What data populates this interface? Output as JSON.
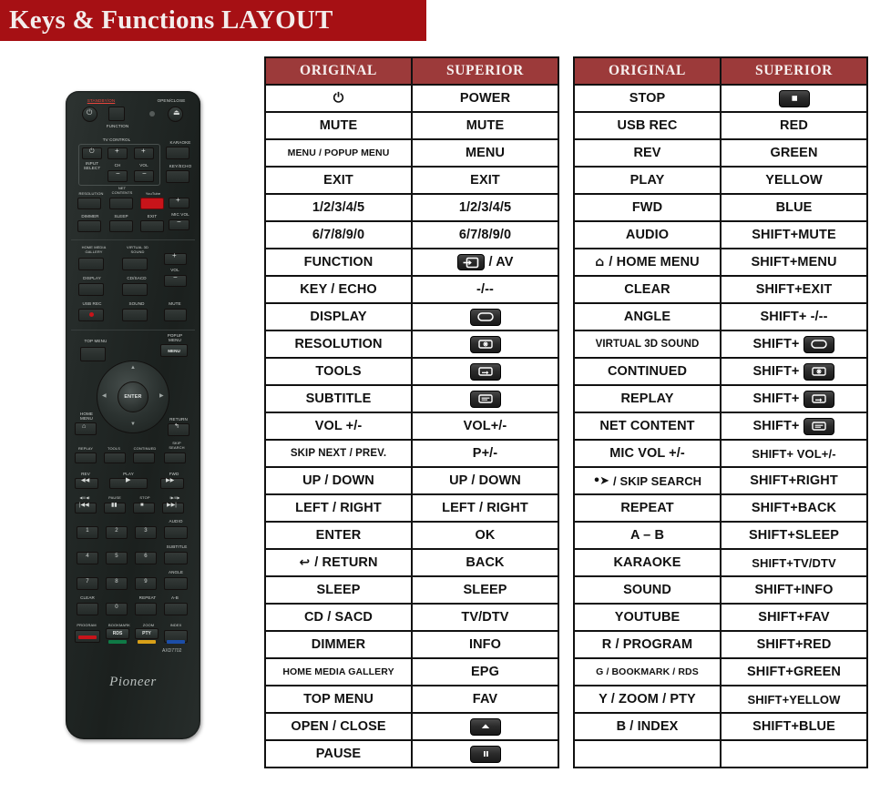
{
  "banner": {
    "title": "Keys & Functions LAYOUT"
  },
  "remote": {
    "brand": "Pioneer",
    "model": "AXD7702",
    "labels": {
      "standby_on": "STANDBY/ON",
      "open_close": "OPEN/CLOSE",
      "function": "FUNCTION",
      "tv_control": "TV CONTROL",
      "input_select": "INPUT\nSELECT",
      "ch": "CH",
      "vol": "VOL",
      "karaoke": "KARAOKE",
      "key_echo": "KEY/ECHO",
      "resolution": "RESOLUTION",
      "net_contents": "NET\nCONTENTS",
      "youtube": "YouTube",
      "dimmer": "DIMMER",
      "sleep": "SLEEP",
      "exit": "EXIT",
      "mic_vol": "MIC VOL",
      "home_media_gallery": "HOME MEDIA\nGALLERY",
      "virtual_3d_sound": "VIRTUAL 3D\nSOUND",
      "vol2": "VOL",
      "display": "DISPLAY",
      "cd_sacd": "CD/SACD",
      "usb_rec": "USB REC",
      "sound": "SOUND",
      "mute": "MUTE",
      "top_menu": "TOP MENU",
      "popup_menu": "POPUP\nMENU",
      "menu_key": "MENU",
      "enter": "ENTER",
      "home_menu": "HOME\nMENU",
      "return": "RETURN",
      "replay": "REPLAY",
      "tools": "TOOLS",
      "continued": "CONTINUED",
      "skip_search": "SKIP\nSEARCH",
      "rev": "REV",
      "play": "PLAY",
      "fwd": "FWD",
      "prev_step": "◀II/◀I",
      "pause": "PAUSE",
      "stop": "STOP",
      "next_step": "I▶/II▶",
      "audio": "AUDIO",
      "subtitle": "SUBTITLE",
      "angle": "ANGLE",
      "clear": "CLEAR",
      "repeat": "REPEAT",
      "ab": "A-B",
      "program": "PROGRAM",
      "bookmark": "BOOKMARK",
      "zoom": "ZOOM",
      "index": "INDEX",
      "rds": "RDS",
      "pty": "PTY",
      "num1": "1",
      "num2": "2",
      "num3": "3",
      "num4": "4",
      "num5": "5",
      "num6": "6",
      "num7": "7",
      "num8": "8",
      "num9": "9",
      "num0": "0"
    },
    "colors": {
      "red": "#c8141a",
      "green": "#0f7a46",
      "yellow": "#d8a018",
      "blue": "#1c4ea8",
      "standby_text": "#e8453c",
      "body": "#23292 7"
    }
  },
  "tables": {
    "headers": {
      "original": "ORIGINAL",
      "superior": "SUPERIOR"
    },
    "left": [
      {
        "original": "⏻",
        "original_type": "power-icon",
        "superior": "POWER"
      },
      {
        "original": "MUTE",
        "superior": "MUTE"
      },
      {
        "original": "MENU / POPUP MENU",
        "original_size": "xs",
        "superior": "MENU"
      },
      {
        "original": "EXIT",
        "superior": "EXIT"
      },
      {
        "original": "1/2/3/4/5",
        "superior": "1/2/3/4/5"
      },
      {
        "original": "6/7/8/9/0",
        "superior": "6/7/8/9/0"
      },
      {
        "original": "FUNCTION",
        "superior": "/ AV",
        "superior_icon": "input-source-icon"
      },
      {
        "original": "KEY / ECHO",
        "superior": "-/--"
      },
      {
        "original": "DISPLAY",
        "superior": "",
        "superior_icon": "display-screen-icon"
      },
      {
        "original": "RESOLUTION",
        "superior": "",
        "superior_icon": "resolution-icon"
      },
      {
        "original": "TOOLS",
        "superior": "",
        "superior_icon": "tools-icon"
      },
      {
        "original": "SUBTITLE",
        "superior": "",
        "superior_icon": "subtitle-icon"
      },
      {
        "original": "VOL +/-",
        "superior": "VOL+/-"
      },
      {
        "original": "SKIP NEXT / PREV.",
        "original_size": "sm",
        "superior": "P+/-"
      },
      {
        "original": "UP / DOWN",
        "superior": "UP / DOWN"
      },
      {
        "original": "LEFT / RIGHT",
        "superior": "LEFT / RIGHT"
      },
      {
        "original": "ENTER",
        "superior": "OK"
      },
      {
        "original": "/ RETURN",
        "original_icon": "return-arrow-icon",
        "superior": "BACK"
      },
      {
        "original": "SLEEP",
        "superior": "SLEEP"
      },
      {
        "original": "CD / SACD",
        "superior": "TV/DTV"
      },
      {
        "original": "DIMMER",
        "superior": "INFO"
      },
      {
        "original": "HOME MEDIA GALLERY",
        "original_size": "xs",
        "superior": "EPG"
      },
      {
        "original": "TOP MENU",
        "superior": "FAV"
      },
      {
        "original": "OPEN / CLOSE",
        "superior": "",
        "superior_icon": "eject-icon"
      },
      {
        "original": "PAUSE",
        "superior": "",
        "superior_icon": "pause-icon"
      }
    ],
    "right": [
      {
        "original": "STOP",
        "superior": "",
        "superior_icon": "stop-icon"
      },
      {
        "original": "USB REC",
        "superior": "RED"
      },
      {
        "original": "REV",
        "superior": "GREEN"
      },
      {
        "original": "PLAY",
        "superior": "YELLOW"
      },
      {
        "original": "FWD",
        "superior": "BLUE"
      },
      {
        "original": "AUDIO",
        "superior": "SHIFT+MUTE"
      },
      {
        "original": "/ HOME MENU",
        "original_icon": "home-icon",
        "superior": "SHIFT+MENU"
      },
      {
        "original": "CLEAR",
        "superior": "SHIFT+EXIT"
      },
      {
        "original": "ANGLE",
        "superior": "SHIFT+ -/--"
      },
      {
        "original": "VIRTUAL 3D SOUND",
        "original_size": "sm",
        "superior": "SHIFT+",
        "superior_icon": "display-screen-icon"
      },
      {
        "original": "CONTINUED",
        "superior": "SHIFT+",
        "superior_icon": "resolution-icon"
      },
      {
        "original": "REPLAY",
        "superior": "SHIFT+",
        "superior_icon": "tools-icon"
      },
      {
        "original": "NET CONTENT",
        "superior": "SHIFT+",
        "superior_icon": "subtitle-icon"
      },
      {
        "original": "MIC VOL +/-",
        "superior": "SHIFT+ VOL+/-",
        "superior_size": "med"
      },
      {
        "original": "/ SKIP SEARCH",
        "original_icon": "skip-search-icon",
        "original_size": "med",
        "superior": "SHIFT+RIGHT"
      },
      {
        "original": "REPEAT",
        "superior": "SHIFT+BACK"
      },
      {
        "original": "A – B",
        "superior": "SHIFT+SLEEP"
      },
      {
        "original": "KARAOKE",
        "superior": "SHIFT+TV/DTV",
        "superior_size": "med"
      },
      {
        "original": "SOUND",
        "superior": "SHIFT+INFO"
      },
      {
        "original": "YOUTUBE",
        "superior": "SHIFT+FAV"
      },
      {
        "original": "R / PROGRAM",
        "superior": "SHIFT+RED"
      },
      {
        "original": "G / BOOKMARK / RDS",
        "original_size": "xs",
        "superior": "SHIFT+GREEN"
      },
      {
        "original": "Y / ZOOM / PTY",
        "superior": "SHIFT+YELLOW",
        "superior_size": "med"
      },
      {
        "original": "B / INDEX",
        "superior": "SHIFT+BLUE"
      },
      {
        "original": "",
        "superior": ""
      }
    ]
  }
}
